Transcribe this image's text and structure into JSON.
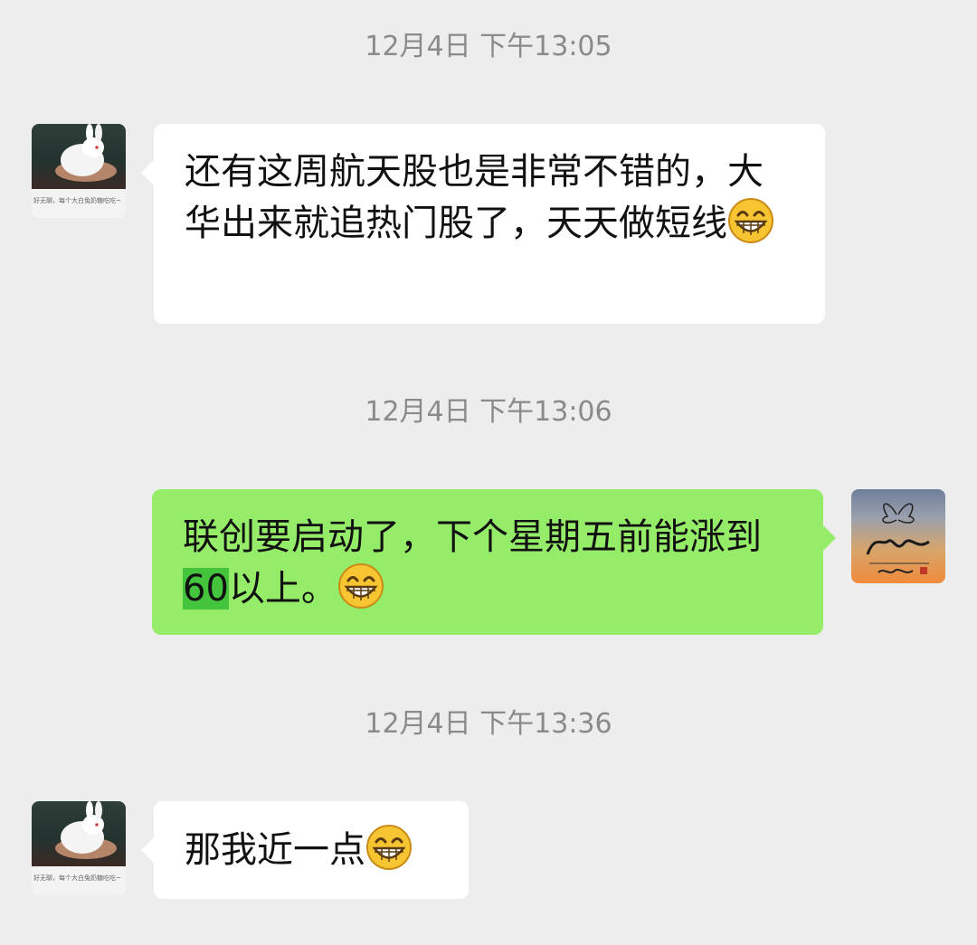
{
  "chat": {
    "messages": [
      {
        "timestamp": "12月4日 下午13:05",
        "sender": "left",
        "avatar_caption": "好无聊，每个大白兔奶糖吃吃~",
        "text": "还有这周航天股也是非常不错的，大华出来就追热门股了，天天做短线",
        "emoji": "grinning-face-icon"
      },
      {
        "timestamp": "12月4日 下午13:06",
        "sender": "right",
        "text_before": "联创要启动了，下个星期五前能涨到",
        "highlight": "60",
        "text_after": "以上。",
        "emoji": "grinning-face-icon"
      },
      {
        "timestamp": "12月4日 下午13:36",
        "sender": "left",
        "avatar_caption": "好无聊，每个大白兔奶糖吃吃~",
        "text": "那我近一点",
        "emoji": "grinning-face-icon"
      }
    ]
  },
  "colors": {
    "background": "#ededed",
    "incoming_bubble": "#ffffff",
    "outgoing_bubble": "#95ec69",
    "highlight": "#43c43c",
    "timestamp": "#8a8a8a"
  }
}
